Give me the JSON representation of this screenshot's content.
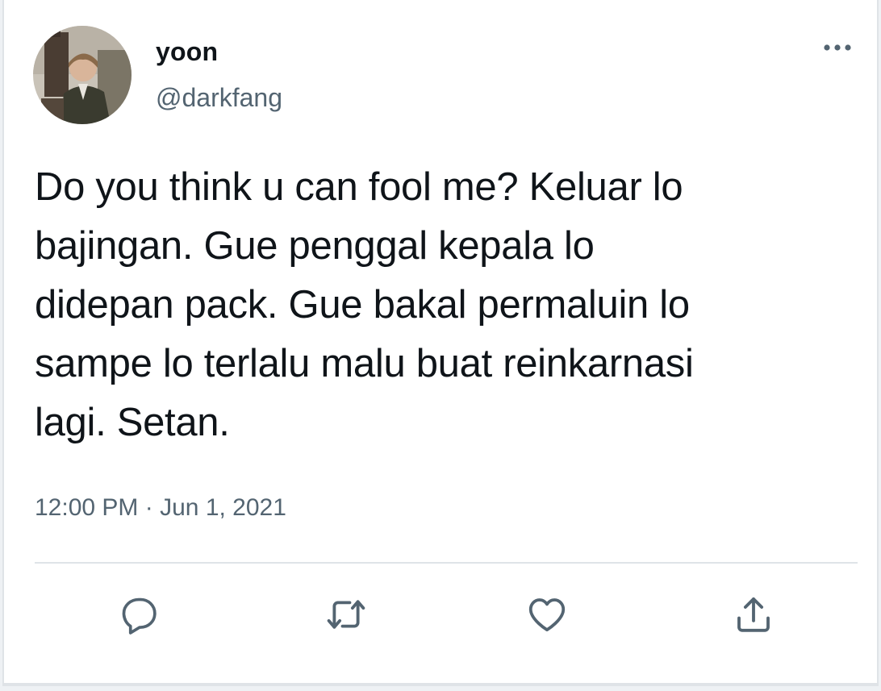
{
  "author": {
    "display_name": "yoon",
    "handle": "@darkfang",
    "avatar_icon": "profile-photo"
  },
  "tweet": {
    "text": "Do you think u can fool me? Keluar lo\nbajingan. Gue penggal kepala lo\ndidepan pack. Gue bakal permaluin lo\nsampe lo terlalu malu buat reinkarnasi\nlagi. Setan.",
    "time": "12:00 PM",
    "separator": "·",
    "date": "Jun 1, 2021"
  },
  "actions": [
    {
      "icon": "reply-icon",
      "label": "Reply"
    },
    {
      "icon": "retweet-icon",
      "label": "Retweet"
    },
    {
      "icon": "like-icon",
      "label": "Like"
    },
    {
      "icon": "share-icon",
      "label": "Share"
    }
  ],
  "colors": {
    "text_primary": "#0f1419",
    "text_secondary": "#536471",
    "divider": "#dfe4e8"
  }
}
